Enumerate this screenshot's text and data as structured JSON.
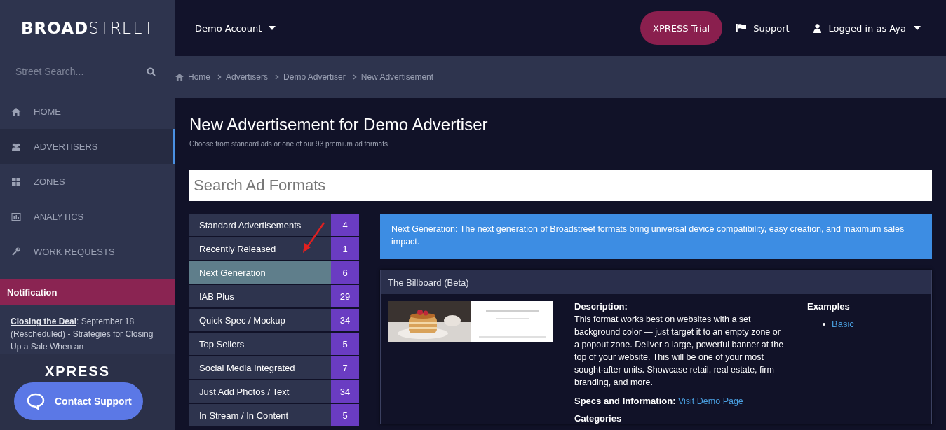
{
  "logo": {
    "bold": "BROAD",
    "light": "STREET"
  },
  "account_menu": {
    "label": "Demo Account"
  },
  "header_actions": {
    "trial_button": "XPRESS Trial",
    "support": "Support",
    "user": "Logged in as Aya"
  },
  "street_search": {
    "placeholder": "Street Search..."
  },
  "breadcrumbs": [
    "Home",
    "Advertisers",
    "Demo Advertiser",
    "New Advertisement"
  ],
  "nav": [
    {
      "label": "HOME",
      "kind": "home",
      "selected": false
    },
    {
      "label": "ADVERTISERS",
      "kind": "users",
      "selected": true
    },
    {
      "label": "ZONES",
      "kind": "grid",
      "selected": false
    },
    {
      "label": "ANALYTICS",
      "kind": "chart",
      "selected": false
    },
    {
      "label": "WORK REQUESTS",
      "kind": "wrench",
      "selected": false
    }
  ],
  "notification": {
    "title": "Notification",
    "link": "Closing the Deal",
    "text": ": September 18 (Rescheduled) - Strategies for Closing Up a Sale When an"
  },
  "sidebar_promo": "XPRESS",
  "contact_support": "Contact Support",
  "page": {
    "title": "New Advertisement for Demo Advertiser",
    "subtitle": "Choose from standard ads or one of our 93 premium ad formats"
  },
  "format_search": {
    "placeholder": "Search Ad Formats"
  },
  "categories": [
    {
      "label": "Standard Advertisements",
      "count": "4",
      "selected": false
    },
    {
      "label": "Recently Released",
      "count": "1",
      "selected": false
    },
    {
      "label": "Next Generation",
      "count": "6",
      "selected": true
    },
    {
      "label": "IAB Plus",
      "count": "29",
      "selected": false
    },
    {
      "label": "Quick Spec / Mockup",
      "count": "34",
      "selected": false
    },
    {
      "label": "Top Sellers",
      "count": "5",
      "selected": false
    },
    {
      "label": "Social Media Integrated",
      "count": "7",
      "selected": false
    },
    {
      "label": "Just Add Photos / Text",
      "count": "34",
      "selected": false
    },
    {
      "label": "In Stream / In Content",
      "count": "5",
      "selected": false
    }
  ],
  "info_banner": "Next Generation: The next generation of Broadstreet formats bring universal device compatibility, easy creation, and maximum sales impact.",
  "format_card": {
    "title": "The Billboard (Beta)",
    "description_label": "Description:",
    "description": "This format works best on websites with a set background color — just target it to an empty zone or a popout zone. Deliver a large, powerful banner at the top of your website. This will be one of your most sought-after units. Showcase retail, real estate, firm branding, and more.",
    "specs_label": "Specs and Information:",
    "specs_link": "Visit Demo Page",
    "categories_label": "Categories",
    "examples_label": "Examples",
    "examples": [
      "Basic"
    ]
  }
}
